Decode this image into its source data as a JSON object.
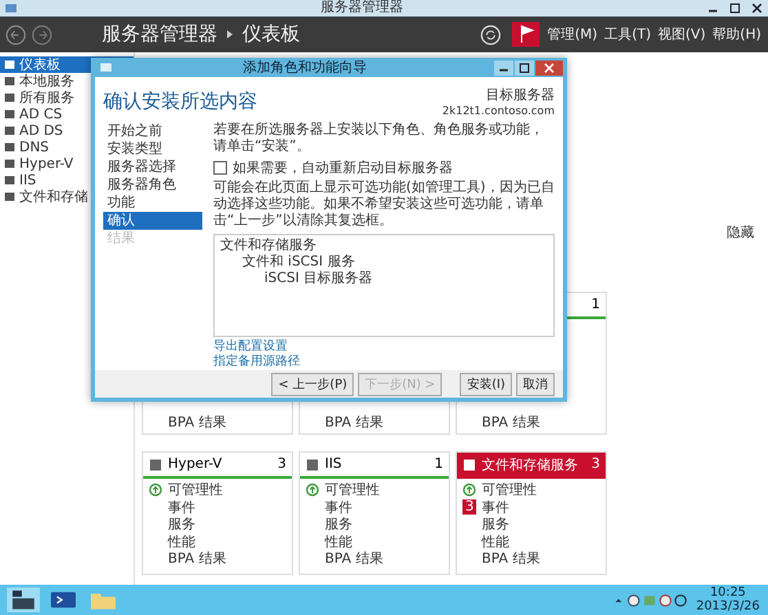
{
  "window": {
    "title": "服务器管理器"
  },
  "header": {
    "title": "服务器管理器",
    "breadcrumb": "仪表板",
    "menus": [
      "管理(M)",
      "工具(T)",
      "视图(V)",
      "帮助(H)"
    ]
  },
  "sidebar": {
    "items": [
      {
        "label": "仪表板",
        "selected": true
      },
      {
        "label": "本地服务",
        "selected": false
      },
      {
        "label": "所有服务",
        "selected": false
      },
      {
        "label": "AD CS",
        "selected": false
      },
      {
        "label": "AD DS",
        "selected": false
      },
      {
        "label": "DNS",
        "selected": false
      },
      {
        "label": "Hyper-V",
        "selected": false
      },
      {
        "label": "IIS",
        "selected": false
      },
      {
        "label": "文件和存储",
        "selected": false
      }
    ]
  },
  "dashboard": {
    "hide_link": "隐藏"
  },
  "tile_rows": [
    [
      {
        "items": [
          {
            "label": "BPA 结果",
            "kind": "plain"
          }
        ]
      },
      {
        "items": [
          {
            "label": "BPA 结果",
            "kind": "plain"
          }
        ]
      },
      {
        "alert": false,
        "count": "1",
        "items": [
          {
            "label": "BPA 结果",
            "kind": "plain"
          }
        ]
      }
    ],
    [
      {
        "name": "Hyper-V",
        "count": "3",
        "alert": false,
        "items": [
          {
            "label": "可管理性",
            "kind": "status"
          },
          {
            "label": "事件",
            "kind": "plain"
          },
          {
            "label": "服务",
            "kind": "plain"
          },
          {
            "label": "性能",
            "kind": "plain"
          },
          {
            "label": "BPA 结果",
            "kind": "plain"
          }
        ]
      },
      {
        "name": "IIS",
        "count": "1",
        "alert": false,
        "items": [
          {
            "label": "可管理性",
            "kind": "status"
          },
          {
            "label": "事件",
            "kind": "plain"
          },
          {
            "label": "服务",
            "kind": "plain"
          },
          {
            "label": "性能",
            "kind": "plain"
          },
          {
            "label": "BPA 结果",
            "kind": "plain"
          }
        ]
      },
      {
        "name": "文件和存储服务",
        "count": "3",
        "alert": true,
        "items": [
          {
            "label": "可管理性",
            "kind": "status"
          },
          {
            "label": "事件",
            "kind": "plain",
            "badge": "3"
          },
          {
            "label": "服务",
            "kind": "plain"
          },
          {
            "label": "性能",
            "kind": "plain"
          },
          {
            "label": "BPA 结果",
            "kind": "plain"
          }
        ]
      }
    ]
  ],
  "dialog": {
    "title": "添加角色和功能向导",
    "heading": "确认安装所选内容",
    "target_label": "目标服务器",
    "target_server": "2k12t1.contoso.com",
    "steps": [
      {
        "label": "开始之前",
        "selected": false,
        "disabled": false
      },
      {
        "label": "安装类型",
        "selected": false,
        "disabled": false
      },
      {
        "label": "服务器选择",
        "selected": false,
        "disabled": false
      },
      {
        "label": "服务器角色",
        "selected": false,
        "disabled": false
      },
      {
        "label": "功能",
        "selected": false,
        "disabled": false
      },
      {
        "label": "确认",
        "selected": true,
        "disabled": false
      },
      {
        "label": "结果",
        "selected": false,
        "disabled": true
      }
    ],
    "intro": "若要在所选服务器上安装以下角色、角色服务或功能，请单击“安装”。",
    "restart": {
      "label": "如果需要，自动重新启动目标服务器",
      "checked": false
    },
    "note": "可能会在此页面上显示可选功能(如管理工具)，因为已自动选择这些功能。如果不希望安装这些可选功能，请单击“上一步”以清除其复选框。",
    "features": [
      {
        "label": "文件和存储服务",
        "children": [
          {
            "label": "文件和 iSCSI 服务",
            "children": [
              {
                "label": "iSCSI 目标服务器"
              }
            ]
          }
        ]
      }
    ],
    "links": [
      "导出配置设置",
      "指定备用源路径"
    ],
    "buttons": [
      {
        "label": "< 上一步(P)",
        "disabled": false
      },
      {
        "label": "下一步(N) >",
        "disabled": true
      },
      {
        "label": "安装(I)",
        "disabled": false
      },
      {
        "label": "取消",
        "disabled": false
      }
    ]
  },
  "taskbar": {
    "time": "10:25",
    "date": "2013/3/26"
  }
}
